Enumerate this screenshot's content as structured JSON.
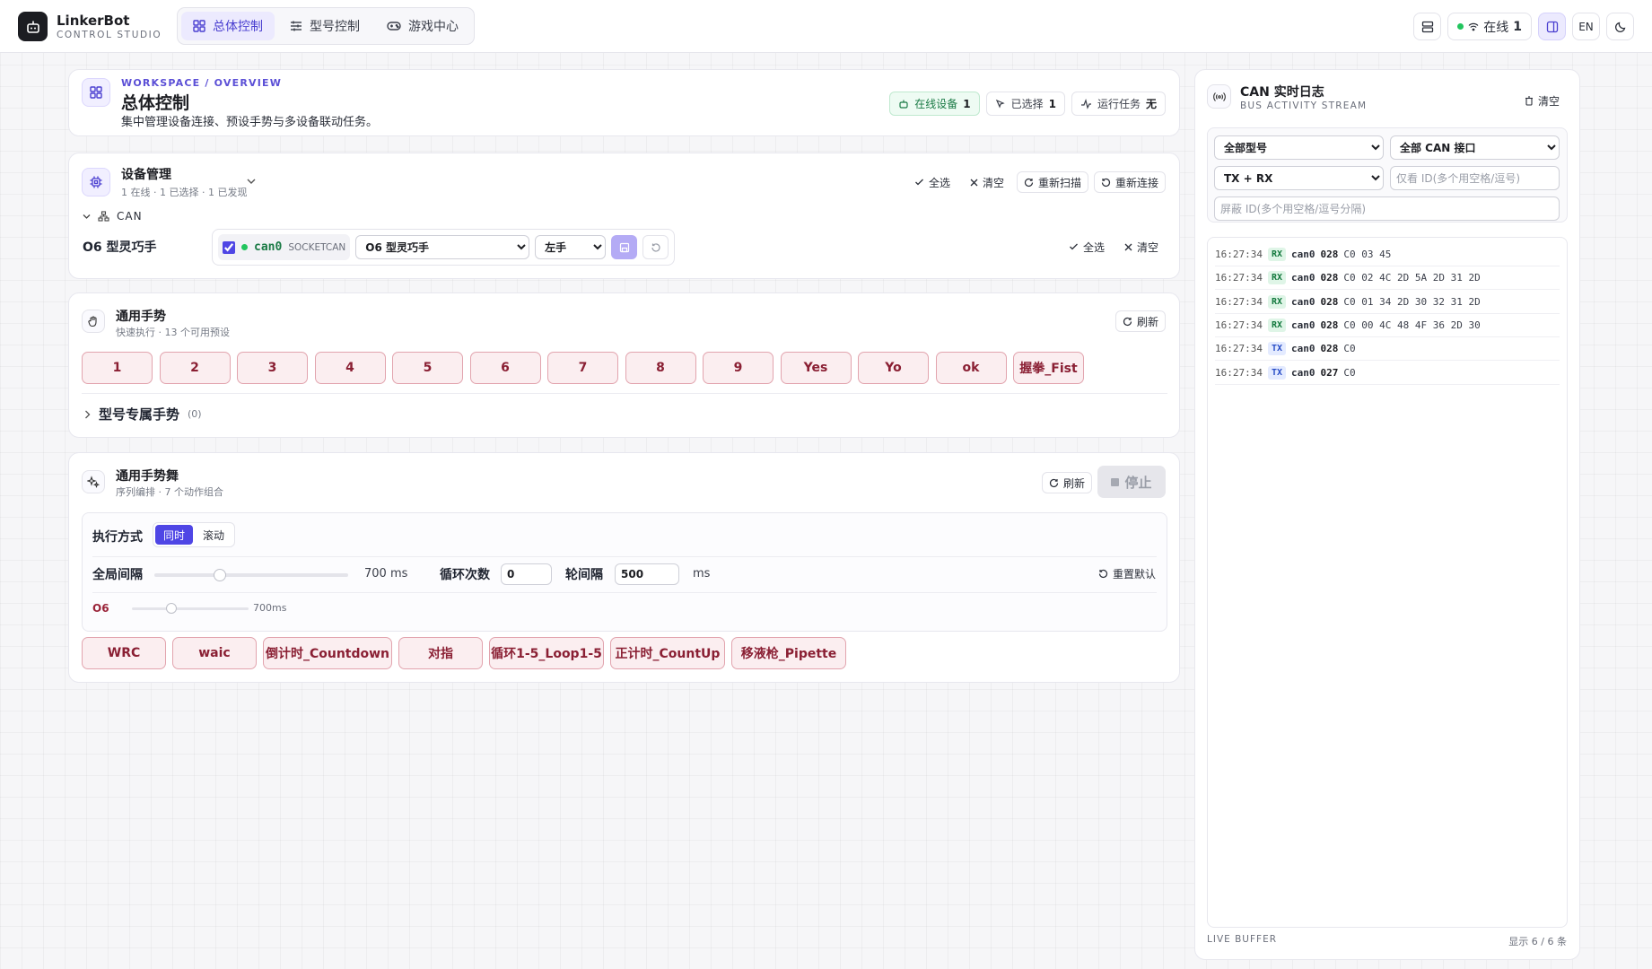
{
  "brand": {
    "name": "LinkerBot",
    "subtitle": "CONTROL STUDIO"
  },
  "nav": {
    "tabs": [
      {
        "label": "总体控制"
      },
      {
        "label": "型号控制"
      },
      {
        "label": "游戏中心"
      }
    ]
  },
  "topbar": {
    "status_label": "在线",
    "status_count": "1",
    "lang": "EN"
  },
  "overview": {
    "eyebrow": "WORKSPACE / OVERVIEW",
    "title": "总体控制",
    "description": "集中管理设备连接、预设手势与多设备联动任务。",
    "stats": {
      "online_label": "在线设备",
      "online_value": "1",
      "selected_label": "已选择",
      "selected_value": "1",
      "tasks_label": "运行任务",
      "tasks_value": "无"
    }
  },
  "devices": {
    "title": "设备管理",
    "summary": "1 在线 · 1 已选择 · 1 已发现",
    "actions": {
      "select_all": "全选",
      "clear": "清空",
      "rescan": "重新扫描",
      "reconnect": "重新连接"
    },
    "group_label": "CAN",
    "device": {
      "name": "O6 型灵巧手",
      "interface": "can0",
      "interface_type": "SOCKETCAN",
      "model": "O6 型灵巧手",
      "hand": "左手",
      "checked": true
    },
    "row_actions": {
      "select_all": "全选",
      "clear": "清空"
    }
  },
  "gestures": {
    "title": "通用手势",
    "subtitle": "快速执行 · 13 个可用预设",
    "refresh": "刷新",
    "items": [
      "1",
      "2",
      "3",
      "4",
      "5",
      "6",
      "7",
      "8",
      "9",
      "Yes",
      "Yo",
      "ok",
      "握拳_Fist"
    ],
    "model_specific_label": "型号专属手势",
    "model_specific_count": "(0)"
  },
  "dance": {
    "title": "通用手势舞",
    "subtitle": "序列编排 · 7 个动作组合",
    "refresh": "刷新",
    "stop": "停止",
    "exec_mode_label": "执行方式",
    "exec_modes": [
      "同时",
      "滚动"
    ],
    "active_mode": "同时",
    "global_interval_label": "全局间隔",
    "global_interval_value": "700 ms",
    "global_interval_fraction": 0.34,
    "loop_count_label": "循环次数",
    "loop_count_value": "0",
    "round_interval_label": "轮间隔",
    "round_interval_value": "500",
    "round_interval_unit": "ms",
    "reset_label": "重置默认",
    "device_label": "O6",
    "device_interval_value": "700ms",
    "device_interval_fraction": 0.34,
    "items": [
      "WRC",
      "waic",
      "倒计时_Countdown",
      "对指",
      "循环1-5_Loop1-5",
      "正计时_CountUp",
      "移液枪_Pipette"
    ]
  },
  "can_log": {
    "title": "CAN 实时日志",
    "subtitle": "BUS ACTIVITY STREAM",
    "clear": "清空",
    "filters": {
      "model": "全部型号",
      "interface": "全部 CAN 接口",
      "direction": "TX + RX",
      "only_id_placeholder": "仅看 ID(多个用空格/逗号)",
      "block_id_placeholder": "屏蔽 ID(多个用空格/逗号分隔)"
    },
    "rows": [
      {
        "time": "16:27:34",
        "dir": "RX",
        "iface": "can0",
        "id": "028",
        "data": "C0 03 45"
      },
      {
        "time": "16:27:34",
        "dir": "RX",
        "iface": "can0",
        "id": "028",
        "data": "C0 02 4C 2D 5A 2D 31 2D"
      },
      {
        "time": "16:27:34",
        "dir": "RX",
        "iface": "can0",
        "id": "028",
        "data": "C0 01 34 2D 30 32 31 2D"
      },
      {
        "time": "16:27:34",
        "dir": "RX",
        "iface": "can0",
        "id": "028",
        "data": "C0 00 4C 48 4F 36 2D 30"
      },
      {
        "time": "16:27:34",
        "dir": "TX",
        "iface": "can0",
        "id": "028",
        "data": "C0"
      },
      {
        "time": "16:27:34",
        "dir": "TX",
        "iface": "can0",
        "id": "027",
        "data": "C0"
      }
    ],
    "footer_left": "LIVE BUFFER",
    "footer_right": "显示 6 / 6 条"
  },
  "colors": {
    "accent": "#4f46e5",
    "online": "#22c55e",
    "gesture_fill": "#fbeef0",
    "gesture_text": "#8a1f33"
  }
}
